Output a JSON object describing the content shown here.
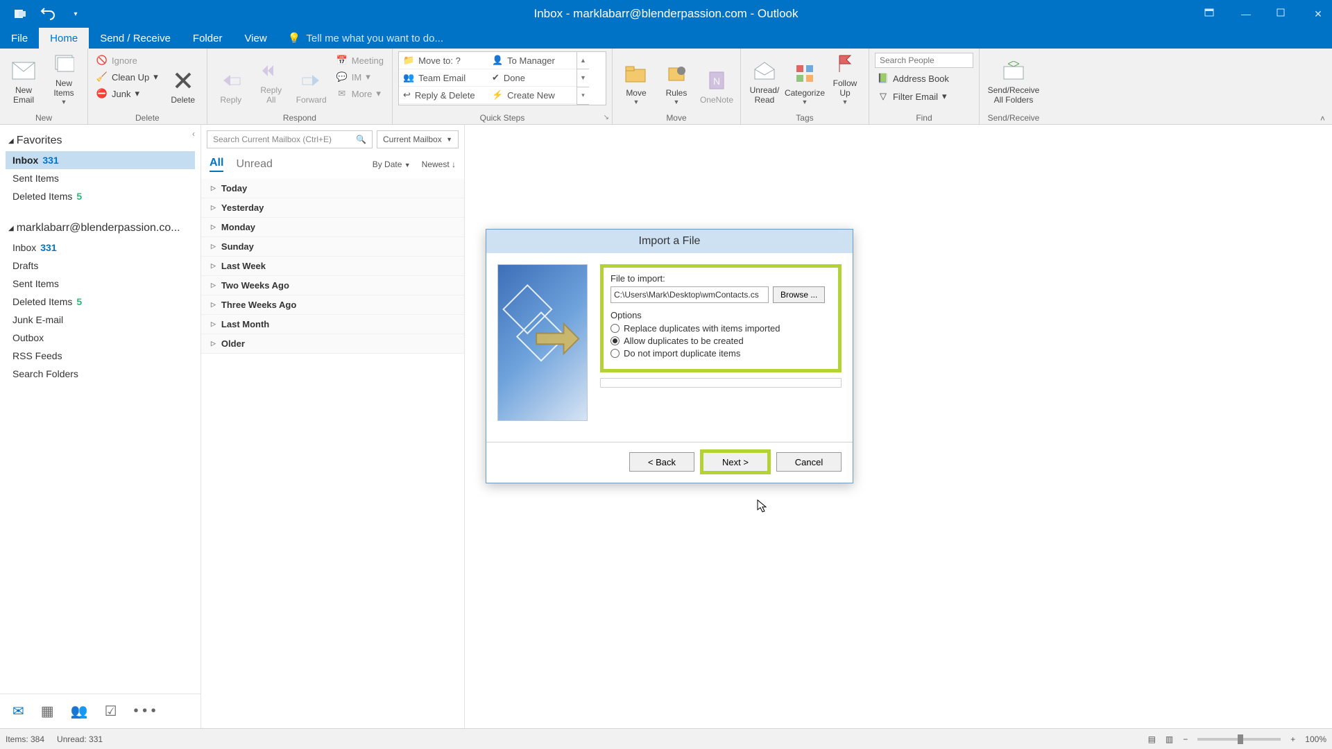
{
  "titlebar": {
    "title": "Inbox - marklabarr@blenderpassion.com - Outlook"
  },
  "tabs": {
    "file": "File",
    "home": "Home",
    "sendreceive": "Send / Receive",
    "folder": "Folder",
    "view": "View",
    "tellme": "Tell me what you want to do..."
  },
  "ribbon": {
    "new": {
      "label": "New",
      "email": "New\nEmail",
      "items": "New\nItems"
    },
    "delete": {
      "label": "Delete",
      "ignore": "Ignore",
      "cleanup": "Clean Up",
      "junk": "Junk",
      "delete": "Delete"
    },
    "respond": {
      "label": "Respond",
      "reply": "Reply",
      "replyall": "Reply\nAll",
      "forward": "Forward",
      "meeting": "Meeting",
      "im": "IM",
      "more": "More"
    },
    "quicksteps": {
      "label": "Quick Steps",
      "moveto": "Move to: ?",
      "teamemail": "Team Email",
      "replydelete": "Reply & Delete",
      "tomanager": "To Manager",
      "done": "Done",
      "createnew": "Create New"
    },
    "move": {
      "label": "Move",
      "move": "Move",
      "rules": "Rules",
      "onenote": "OneNote"
    },
    "tags": {
      "label": "Tags",
      "unread": "Unread/\nRead",
      "categorize": "Categorize",
      "followup": "Follow\nUp"
    },
    "find": {
      "label": "Find",
      "searchplaceholder": "Search People",
      "addressbook": "Address Book",
      "filteremail": "Filter Email"
    },
    "sendreceive": {
      "label": "Send/Receive",
      "button": "Send/Receive\nAll Folders"
    }
  },
  "nav": {
    "favorites": "Favorites",
    "account": "marklabarr@blenderpassion.co...",
    "items": {
      "inbox": "Inbox",
      "inbox_count": "331",
      "sent": "Sent Items",
      "deleted": "Deleted Items",
      "deleted_count": "5",
      "drafts": "Drafts",
      "junk": "Junk E-mail",
      "outbox": "Outbox",
      "rss": "RSS Feeds",
      "searchfolders": "Search Folders"
    }
  },
  "msglist": {
    "search_placeholder": "Search Current Mailbox (Ctrl+E)",
    "scope": "Current Mailbox",
    "filter_all": "All",
    "filter_unread": "Unread",
    "sort1": "By Date",
    "sort2": "Newest",
    "groups": [
      "Today",
      "Yesterday",
      "Monday",
      "Sunday",
      "Last Week",
      "Two Weeks Ago",
      "Three Weeks Ago",
      "Last Month",
      "Older"
    ]
  },
  "dialog": {
    "title": "Import a File",
    "file_label": "File to import:",
    "file_path": "C:\\Users\\Mark\\Desktop\\wmContacts.cs",
    "browse": "Browse ...",
    "options": "Options",
    "opt_replace": "Replace duplicates with items imported",
    "opt_allow": "Allow duplicates to be created",
    "opt_nodup": "Do not import duplicate items",
    "back": "< Back",
    "next": "Next >",
    "cancel": "Cancel"
  },
  "status": {
    "items": "Items: 384",
    "unread": "Unread: 331",
    "zoom": "100%"
  }
}
